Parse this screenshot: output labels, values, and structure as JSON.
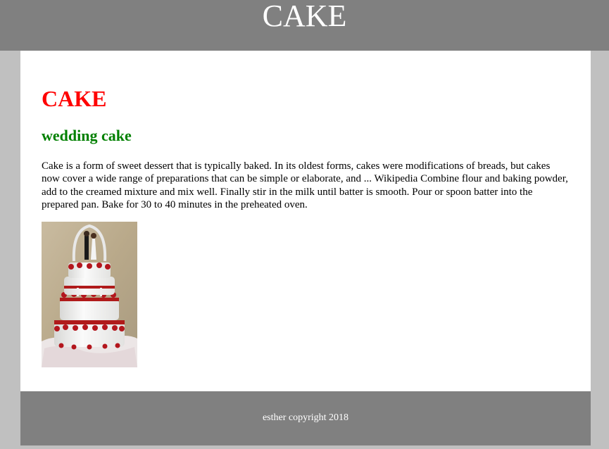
{
  "header": {
    "title": "CAKE"
  },
  "article": {
    "title": "CAKE",
    "subtitle": "wedding cake",
    "body": "Cake is a form of sweet dessert that is typically baked. In its oldest forms, cakes were modifications of breads, but cakes now cover a wide range of preparations that can be simple or elaborate, and ... Wikipedia Combine flour and baking powder, add to the creamed mixture and mix well. Finally stir in the milk until batter is smooth. Pour or spoon batter into the prepared pan. Bake for 30 to 40 minutes in the preheated oven."
  },
  "footer": {
    "text": "esther copyright 2018"
  },
  "colors": {
    "header_bg": "#808080",
    "page_bg": "#c0c0c0",
    "title_red": "#ff0000",
    "subtitle_green": "#008000"
  }
}
